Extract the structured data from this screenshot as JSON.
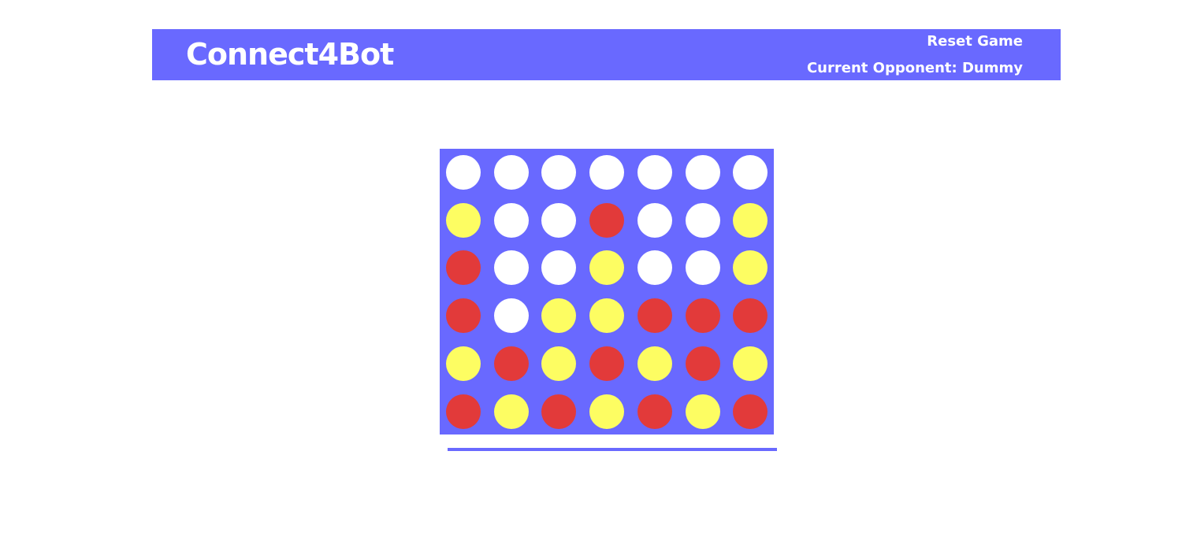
{
  "header": {
    "title": "Connect4Bot",
    "reset_label": "Reset Game",
    "opponent_label": "Current Opponent: Dummy"
  },
  "colors": {
    "accent": "#6969ff",
    "empty": "#ffffff",
    "red": "#e23a3a",
    "yellow": "#fdfd62"
  },
  "board": {
    "rows": 6,
    "cols": 7,
    "cells": [
      [
        "empty",
        "empty",
        "empty",
        "empty",
        "empty",
        "empty",
        "empty"
      ],
      [
        "yellow",
        "empty",
        "empty",
        "red",
        "empty",
        "empty",
        "yellow"
      ],
      [
        "red",
        "empty",
        "empty",
        "yellow",
        "empty",
        "empty",
        "yellow"
      ],
      [
        "red",
        "empty",
        "yellow",
        "yellow",
        "red",
        "red",
        "red"
      ],
      [
        "yellow",
        "red",
        "yellow",
        "red",
        "yellow",
        "red",
        "yellow"
      ],
      [
        "red",
        "yellow",
        "red",
        "yellow",
        "red",
        "yellow",
        "red"
      ]
    ]
  }
}
